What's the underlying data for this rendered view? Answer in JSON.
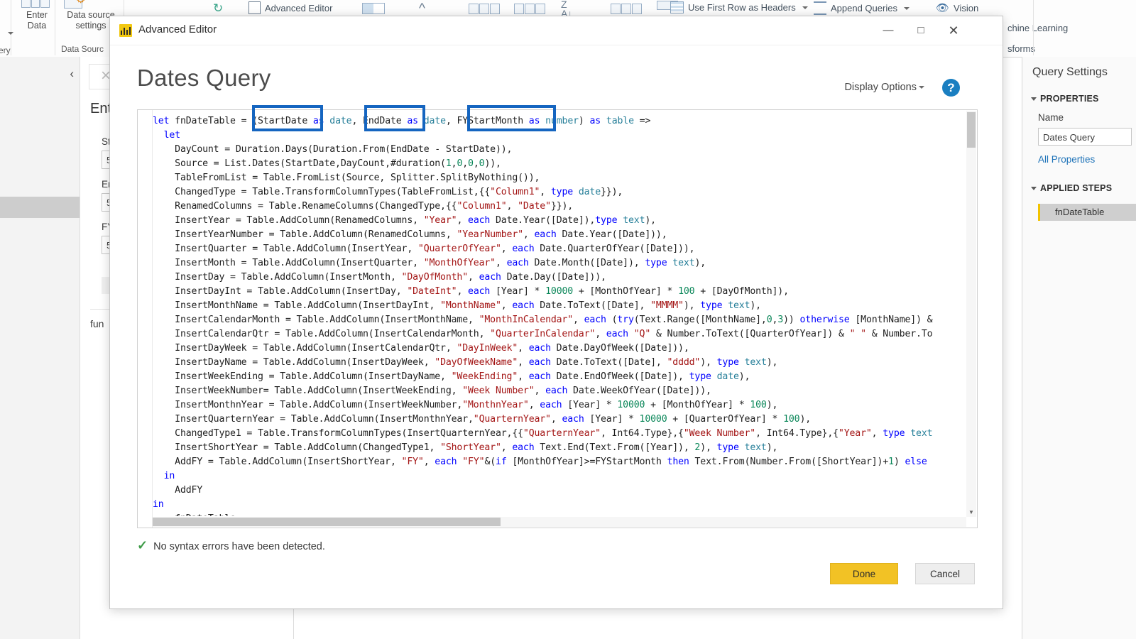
{
  "ribbon": {
    "groups": [
      {
        "label": "Data Sources",
        "buttons": []
      }
    ],
    "buttons": [
      {
        "name": "new-source-button",
        "label": ""
      },
      {
        "name": "enter-data-button",
        "label": "Enter\nData"
      },
      {
        "name": "enter-data-line1",
        "label": "Enter"
      },
      {
        "name": "enter-data-line2",
        "label": "Data"
      },
      {
        "name": "data-source-settings-line1",
        "label": "Data source"
      },
      {
        "name": "data-source-settings-line2",
        "label": "settings"
      },
      {
        "name": "advanced-editor-button",
        "label": "Advanced Editor"
      },
      {
        "name": "use-first-row-as-headers-button",
        "label": "Use First Row as Headers"
      },
      {
        "name": "append-queries-button",
        "label": "Append Queries"
      },
      {
        "name": "vision-button",
        "label": "Vision"
      },
      {
        "name": "machine-learning-button",
        "label": "chine Learning"
      },
      {
        "name": "transforms-button",
        "label": "sforms"
      }
    ],
    "group_labels": [
      {
        "name": "group-label-query",
        "label": "ery"
      },
      {
        "name": "group-label-data-sources",
        "label": "Data Sourc"
      }
    ]
  },
  "left_pane": {
    "collapse_icon": "chevron-left-icon"
  },
  "mid_pane": {
    "close_label": "×",
    "title": "Ent",
    "fields": [
      {
        "label": "St",
        "value": "5"
      },
      {
        "label": "En",
        "value": "5"
      },
      {
        "label": "FY",
        "value": "5"
      }
    ],
    "function_label": "fun"
  },
  "query_settings": {
    "title": "Query Settings",
    "properties_section": "PROPERTIES",
    "name_label": "Name",
    "name_value": "Dates Query",
    "all_properties_link": "All Properties",
    "applied_steps_section": "APPLIED STEPS",
    "steps": [
      {
        "label": "fnDateTable"
      }
    ]
  },
  "dialog": {
    "window_title": "Advanced Editor",
    "heading": "Dates Query",
    "display_options_label": "Display Options",
    "help_label": "?",
    "minimize_label": "—",
    "maximize_label": "□",
    "close_label": "✕",
    "status_text": "No syntax errors have been detected.",
    "status_icon": "check-icon",
    "done_label": "Done",
    "cancel_label": "Cancel"
  },
  "code": {
    "language": "M (Power Query)",
    "highlighted_params": [
      "StartDate",
      "EndDate",
      "FYStartMonth"
    ],
    "lines": [
      "let fnDateTable = (StartDate as date, EndDate as date, FYStartMonth as number) as table =>",
      "  let",
      "    DayCount = Duration.Days(Duration.From(EndDate - StartDate)),",
      "    Source = List.Dates(StartDate,DayCount,#duration(1,0,0,0)),",
      "    TableFromList = Table.FromList(Source, Splitter.SplitByNothing()),",
      "    ChangedType = Table.TransformColumnTypes(TableFromList,{{\"Column1\", type date}}),",
      "    RenamedColumns = Table.RenameColumns(ChangedType,{{\"Column1\", \"Date\"}}),",
      "    InsertYear = Table.AddColumn(RenamedColumns, \"Year\", each Date.Year([Date]),type text),",
      "    InsertYearNumber = Table.AddColumn(RenamedColumns, \"YearNumber\", each Date.Year([Date])),",
      "    InsertQuarter = Table.AddColumn(InsertYear, \"QuarterOfYear\", each Date.QuarterOfYear([Date])),",
      "    InsertMonth = Table.AddColumn(InsertQuarter, \"MonthOfYear\", each Date.Month([Date]), type text),",
      "    InsertDay = Table.AddColumn(InsertMonth, \"DayOfMonth\", each Date.Day([Date])),",
      "    InsertDayInt = Table.AddColumn(InsertDay, \"DateInt\", each [Year] * 10000 + [MonthOfYear] * 100 + [DayOfMonth]),",
      "    InsertMonthName = Table.AddColumn(InsertDayInt, \"MonthName\", each Date.ToText([Date], \"MMMM\"), type text),",
      "    InsertCalendarMonth = Table.AddColumn(InsertMonthName, \"MonthInCalendar\", each (try(Text.Range([MonthName],0,3)) otherwise [MonthName]) &",
      "    InsertCalendarQtr = Table.AddColumn(InsertCalendarMonth, \"QuarterInCalendar\", each \"Q\" & Number.ToText([QuarterOfYear]) & \" \" & Number.To",
      "    InsertDayWeek = Table.AddColumn(InsertCalendarQtr, \"DayInWeek\", each Date.DayOfWeek([Date])),",
      "    InsertDayName = Table.AddColumn(InsertDayWeek, \"DayOfWeekName\", each Date.ToText([Date], \"dddd\"), type text),",
      "    InsertWeekEnding = Table.AddColumn(InsertDayName, \"WeekEnding\", each Date.EndOfWeek([Date]), type date),",
      "    InsertWeekNumber= Table.AddColumn(InsertWeekEnding, \"Week Number\", each Date.WeekOfYear([Date])),",
      "    InsertMonthnYear = Table.AddColumn(InsertWeekNumber,\"MonthnYear\", each [Year] * 10000 + [MonthOfYear] * 100),",
      "    InsertQuarternYear = Table.AddColumn(InsertMonthnYear,\"QuarternYear\", each [Year] * 10000 + [QuarterOfYear] * 100),",
      "    ChangedType1 = Table.TransformColumnTypes(InsertQuarternYear,{{\"QuarternYear\", Int64.Type},{\"Week Number\", Int64.Type},{\"Year\", type text",
      "    InsertShortYear = Table.AddColumn(ChangedType1, \"ShortYear\", each Text.End(Text.From([Year]), 2), type text),",
      "    AddFY = Table.AddColumn(InsertShortYear, \"FY\", each \"FY\"&(if [MonthOfYear]>=FYStartMonth then Text.From(Number.From([ShortYear])+1) else",
      "  in",
      "    AddFY",
      "in",
      "    fnDateTable"
    ]
  },
  "colors": {
    "accent_highlight": "#1565c0",
    "done_button": "#f2c225",
    "keyword": "#0000ff",
    "string": "#a31515",
    "number": "#098658",
    "type": "#267f99",
    "link": "#1d72b8",
    "success": "#3f9c49"
  }
}
